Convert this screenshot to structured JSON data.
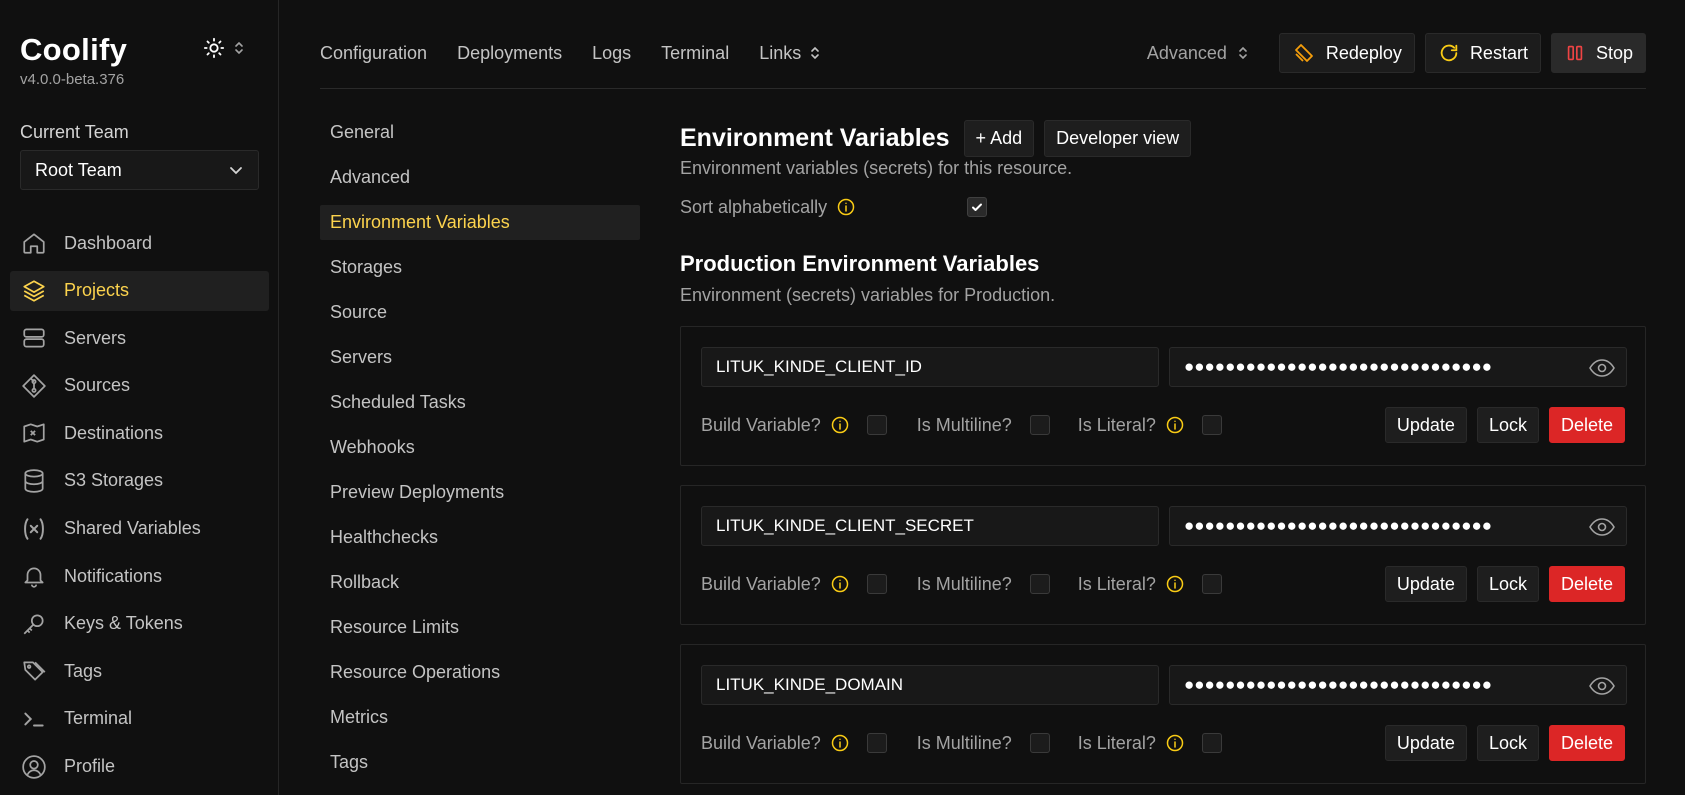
{
  "brand": {
    "name": "Coolify",
    "version": "v4.0.0-beta.376"
  },
  "team": {
    "label": "Current Team",
    "selected": "Root Team"
  },
  "sidebar": {
    "items": [
      {
        "label": "Dashboard",
        "icon": "home-icon",
        "active": false
      },
      {
        "label": "Projects",
        "icon": "layers-icon",
        "active": true
      },
      {
        "label": "Servers",
        "icon": "server-icon",
        "active": false
      },
      {
        "label": "Sources",
        "icon": "git-icon",
        "active": false
      },
      {
        "label": "Destinations",
        "icon": "destination-icon",
        "active": false
      },
      {
        "label": "S3 Storages",
        "icon": "database-icon",
        "active": false
      },
      {
        "label": "Shared Variables",
        "icon": "variable-icon",
        "active": false
      },
      {
        "label": "Notifications",
        "icon": "bell-icon",
        "active": false
      },
      {
        "label": "Keys & Tokens",
        "icon": "key-icon",
        "active": false
      },
      {
        "label": "Tags",
        "icon": "tags-icon",
        "active": false
      },
      {
        "label": "Terminal",
        "icon": "terminal-icon",
        "active": false
      },
      {
        "label": "Profile",
        "icon": "user-icon",
        "active": false
      }
    ]
  },
  "topnav": {
    "tabs": [
      "Configuration",
      "Deployments",
      "Logs",
      "Terminal",
      "Links"
    ],
    "advanced": "Advanced",
    "redeploy": "Redeploy",
    "restart": "Restart",
    "stop": "Stop"
  },
  "submenu": {
    "items": [
      {
        "label": "General",
        "active": false
      },
      {
        "label": "Advanced",
        "active": false
      },
      {
        "label": "Environment Variables",
        "active": true
      },
      {
        "label": "Storages",
        "active": false
      },
      {
        "label": "Source",
        "active": false
      },
      {
        "label": "Servers",
        "active": false
      },
      {
        "label": "Scheduled Tasks",
        "active": false
      },
      {
        "label": "Webhooks",
        "active": false
      },
      {
        "label": "Preview Deployments",
        "active": false
      },
      {
        "label": "Healthchecks",
        "active": false
      },
      {
        "label": "Rollback",
        "active": false
      },
      {
        "label": "Resource Limits",
        "active": false
      },
      {
        "label": "Resource Operations",
        "active": false
      },
      {
        "label": "Metrics",
        "active": false
      },
      {
        "label": "Tags",
        "active": false
      }
    ]
  },
  "main": {
    "title": "Environment Variables",
    "add_label": "+ Add",
    "dev_view_label": "Developer view",
    "description": "Environment variables (secrets) for this resource.",
    "sort_label": "Sort alphabetically",
    "sort_checked": true,
    "production_title": "Production Environment Variables",
    "production_desc": "Environment (secrets) variables for Production.",
    "option_labels": {
      "build": "Build Variable?",
      "multiline": "Is Multiline?",
      "literal": "Is Literal?"
    },
    "button_labels": {
      "update": "Update",
      "lock": "Lock",
      "delete": "Delete"
    },
    "variables": [
      {
        "name": "LITUK_KINDE_CLIENT_ID",
        "value_mask": "●●●●●●●●●●●●●●●●●●●●●●●●●●●●●●"
      },
      {
        "name": "LITUK_KINDE_CLIENT_SECRET",
        "value_mask": "●●●●●●●●●●●●●●●●●●●●●●●●●●●●●●"
      },
      {
        "name": "LITUK_KINDE_DOMAIN",
        "value_mask": "●●●●●●●●●●●●●●●●●●●●●●●●●●●●●●"
      }
    ]
  },
  "colors": {
    "accent": "#fcd34d",
    "danger": "#dc2626",
    "bg": "#101010"
  }
}
